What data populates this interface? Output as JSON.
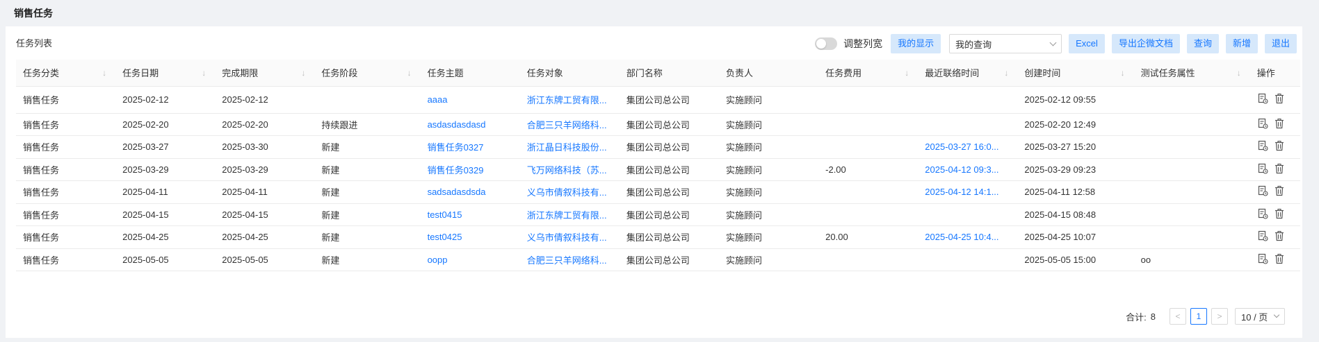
{
  "page": {
    "title": "销售任务"
  },
  "card": {
    "title": "任务列表"
  },
  "toolbar": {
    "toggle_label": "调整列宽",
    "my_display": "我的显示",
    "my_query_select": "我的查询",
    "excel": "Excel",
    "export_wecom": "导出企微文档",
    "query": "查询",
    "add": "新增",
    "exit": "退出"
  },
  "table": {
    "columns": [
      "任务分类",
      "任务日期",
      "完成期限",
      "任务阶段",
      "任务主题",
      "任务对象",
      "部门名称",
      "负责人",
      "任务费用",
      "最近联络时间",
      "创建时间",
      "测试任务属性",
      "操作"
    ],
    "rows": [
      {
        "category": "销售任务",
        "date": "2025-02-12",
        "deadline": "2025-02-12",
        "stage": "",
        "subject": "aaaa",
        "target": "浙江东牌工贸有限...",
        "dept": "集团公司总公司",
        "owner": "实施顾问",
        "cost": "",
        "last_contact": "",
        "created": "2025-02-12 09:55",
        "test_attr": ""
      },
      {
        "category": "销售任务",
        "date": "2025-02-20",
        "deadline": "2025-02-20",
        "stage": "持续跟进",
        "subject": "asdasdasdasd",
        "target": "合肥三只羊网络科...",
        "dept": "集团公司总公司",
        "owner": "实施顾问",
        "cost": "",
        "last_contact": "",
        "created": "2025-02-20 12:49",
        "test_attr": ""
      },
      {
        "category": "销售任务",
        "date": "2025-03-27",
        "deadline": "2025-03-30",
        "stage": "新建",
        "subject": "销售任务0327",
        "target": "浙江晶日科技股份...",
        "dept": "集团公司总公司",
        "owner": "实施顾问",
        "cost": "",
        "last_contact": "2025-03-27 16:0...",
        "created": "2025-03-27 15:20",
        "test_attr": ""
      },
      {
        "category": "销售任务",
        "date": "2025-03-29",
        "deadline": "2025-03-29",
        "stage": "新建",
        "subject": "销售任务0329",
        "target": "飞万网络科技（苏...",
        "dept": "集团公司总公司",
        "owner": "实施顾问",
        "cost": "-2.00",
        "last_contact": "2025-04-12 09:3...",
        "created": "2025-03-29 09:23",
        "test_attr": ""
      },
      {
        "category": "销售任务",
        "date": "2025-04-11",
        "deadline": "2025-04-11",
        "stage": "新建",
        "subject": "sadsadasdsda",
        "target": "义乌市倩叙科技有...",
        "dept": "集团公司总公司",
        "owner": "实施顾问",
        "cost": "",
        "last_contact": "2025-04-12 14:1...",
        "created": "2025-04-11 12:58",
        "test_attr": ""
      },
      {
        "category": "销售任务",
        "date": "2025-04-15",
        "deadline": "2025-04-15",
        "stage": "新建",
        "subject": "test0415",
        "target": "浙江东牌工贸有限...",
        "dept": "集团公司总公司",
        "owner": "实施顾问",
        "cost": "",
        "last_contact": "",
        "created": "2025-04-15 08:48",
        "test_attr": ""
      },
      {
        "category": "销售任务",
        "date": "2025-04-25",
        "deadline": "2025-04-25",
        "stage": "新建",
        "subject": "test0425",
        "target": "义乌市倩叙科技有...",
        "dept": "集团公司总公司",
        "owner": "实施顾问",
        "cost": "20.00",
        "last_contact": "2025-04-25 10:4...",
        "created": "2025-04-25 10:07",
        "test_attr": ""
      },
      {
        "category": "销售任务",
        "date": "2025-05-05",
        "deadline": "2025-05-05",
        "stage": "新建",
        "subject": "oopp",
        "target": "合肥三只羊网络科...",
        "dept": "集团公司总公司",
        "owner": "实施顾问",
        "cost": "",
        "last_contact": "",
        "created": "2025-05-05 15:00",
        "test_attr": "oo"
      }
    ]
  },
  "pagination": {
    "total_label": "合计:",
    "total": "8",
    "prev": "<",
    "current_page": "1",
    "next": ">",
    "page_size": "10 / 页"
  },
  "colors": {
    "accent": "#1677ff",
    "button_bg": "#d6e8fb"
  }
}
